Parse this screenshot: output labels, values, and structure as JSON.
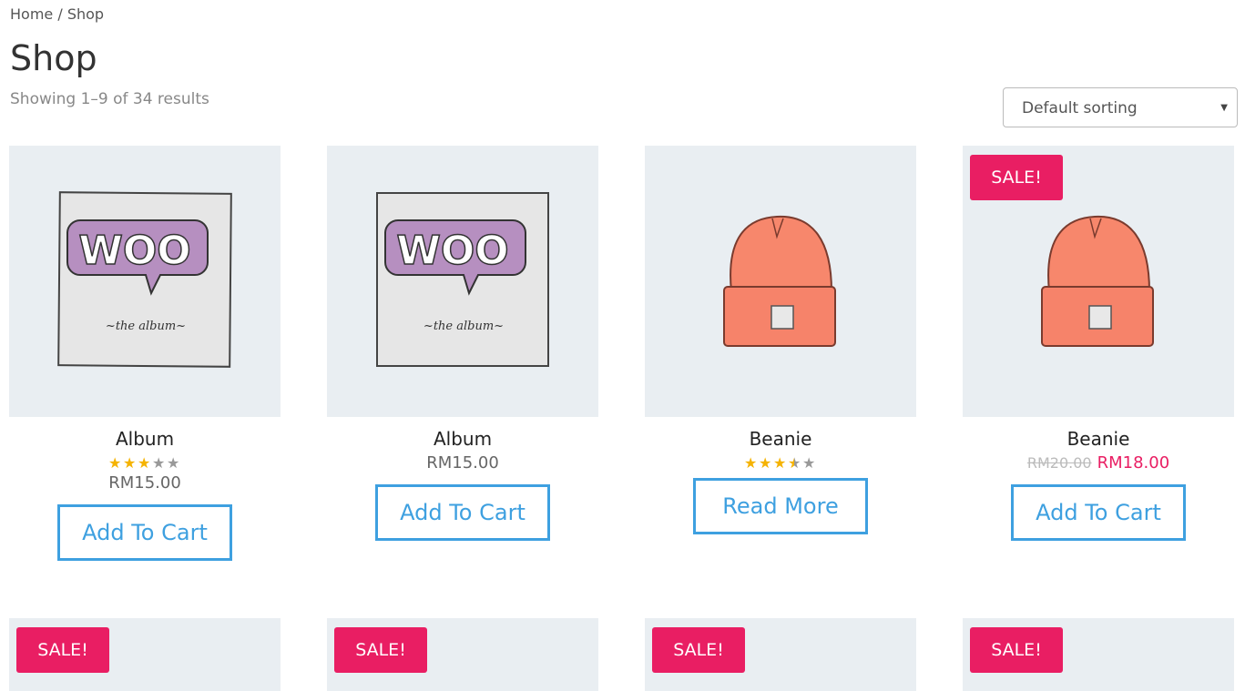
{
  "breadcrumb": {
    "home": "Home",
    "separator": " / ",
    "current": "Shop"
  },
  "page_title": "Shop",
  "result_count": "Showing 1–9 of 34 results",
  "sorting": {
    "selected": "Default sorting"
  },
  "products": [
    {
      "title": "Album",
      "rating": 3,
      "price": "RM15.00",
      "button": "Add To Cart",
      "image": "woo-album-icon"
    },
    {
      "title": "Album",
      "price": "RM15.00",
      "button": "Add To Cart",
      "image": "woo-album-icon"
    },
    {
      "title": "Beanie",
      "rating": 3.5,
      "button": "Read More",
      "image": "beanie-icon"
    },
    {
      "title": "Beanie",
      "badge": "SALE!",
      "old_price": "RM20.00",
      "new_price": "RM18.00",
      "button": "Add To Cart",
      "image": "beanie-icon"
    }
  ],
  "row2_badges": [
    "SALE!",
    "SALE!",
    "SALE!",
    "SALE!"
  ],
  "colors": {
    "accent": "#3ea0e0",
    "sale": "#e91e63",
    "star": "#f5b301",
    "thumb_bg": "#e9eef2"
  }
}
